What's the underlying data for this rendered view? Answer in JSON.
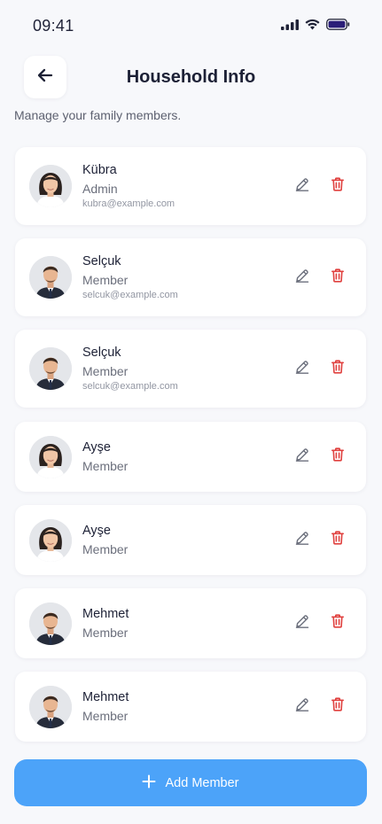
{
  "status_bar": {
    "time": "09:41"
  },
  "header": {
    "title": "Household Info",
    "subtitle": "Manage your family members."
  },
  "members": [
    {
      "name": "Kübra",
      "role": "Admin",
      "email": "kubra@example.com",
      "avatar": "woman"
    },
    {
      "name": "Selçuk",
      "role": "Member",
      "email": "selcuk@example.com",
      "avatar": "man"
    },
    {
      "name": "Selçuk",
      "role": "Member",
      "email": "selcuk@example.com",
      "avatar": "man"
    },
    {
      "name": "Ayşe",
      "role": "Member",
      "avatar": "woman"
    },
    {
      "name": "Ayşe",
      "role": "Member",
      "avatar": "woman"
    },
    {
      "name": "Mehmet",
      "role": "Member",
      "avatar": "man"
    },
    {
      "name": "Mehmet",
      "role": "Member",
      "avatar": "man"
    }
  ],
  "actions": {
    "add_member_label": "Add Member"
  },
  "colors": {
    "background": "#f7f8fb",
    "primary": "#4ca3f9",
    "delete": "#e0413f",
    "edit": "#6b6f7c",
    "title": "#1d2136"
  },
  "icons": {
    "back": "arrow-left-icon",
    "edit": "pencil-icon",
    "delete": "trash-icon",
    "add": "plus-icon"
  }
}
